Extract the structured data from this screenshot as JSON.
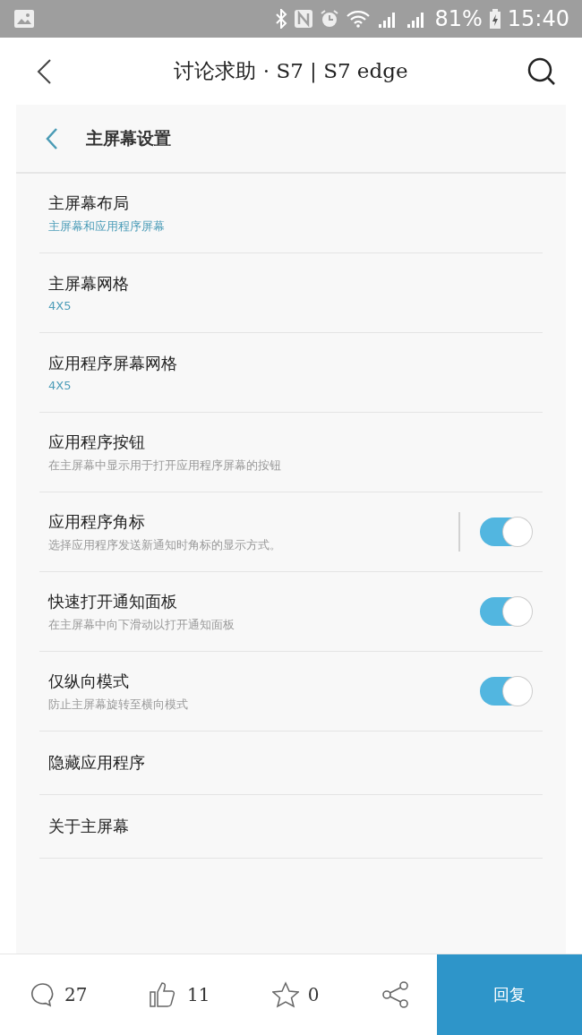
{
  "status_bar": {
    "battery": "81%",
    "time": "15:40"
  },
  "header": {
    "title": "讨论求助 · S7 | S7 edge"
  },
  "settings_panel": {
    "title": "主屏幕设置",
    "items": [
      {
        "kind": "value",
        "title": "主屏幕布局",
        "subtitle": "主屏幕和应用程序屏幕"
      },
      {
        "kind": "value",
        "title": "主屏幕网格",
        "subtitle": "4X5"
      },
      {
        "kind": "value",
        "title": "应用程序屏幕网格",
        "subtitle": "4X5"
      },
      {
        "kind": "info",
        "title": "应用程序按钮",
        "subtitle": "在主屏幕中显示用于打开应用程序屏幕的按钮"
      },
      {
        "kind": "toggle",
        "title": "应用程序角标",
        "subtitle": "选择应用程序发送新通知时角标的显示方式。",
        "on": true,
        "divider": true
      },
      {
        "kind": "toggle",
        "title": "快速打开通知面板",
        "subtitle": "在主屏幕中向下滑动以打开通知面板",
        "on": true,
        "divider": false
      },
      {
        "kind": "toggle",
        "title": "仅纵向模式",
        "subtitle": "防止主屏幕旋转至横向模式",
        "on": true,
        "divider": false
      },
      {
        "kind": "plain",
        "title": "隐藏应用程序"
      },
      {
        "kind": "plain",
        "title": "关于主屏幕"
      }
    ]
  },
  "bottom_bar": {
    "comments": "27",
    "likes": "11",
    "favorites": "0",
    "reply": "回复"
  }
}
